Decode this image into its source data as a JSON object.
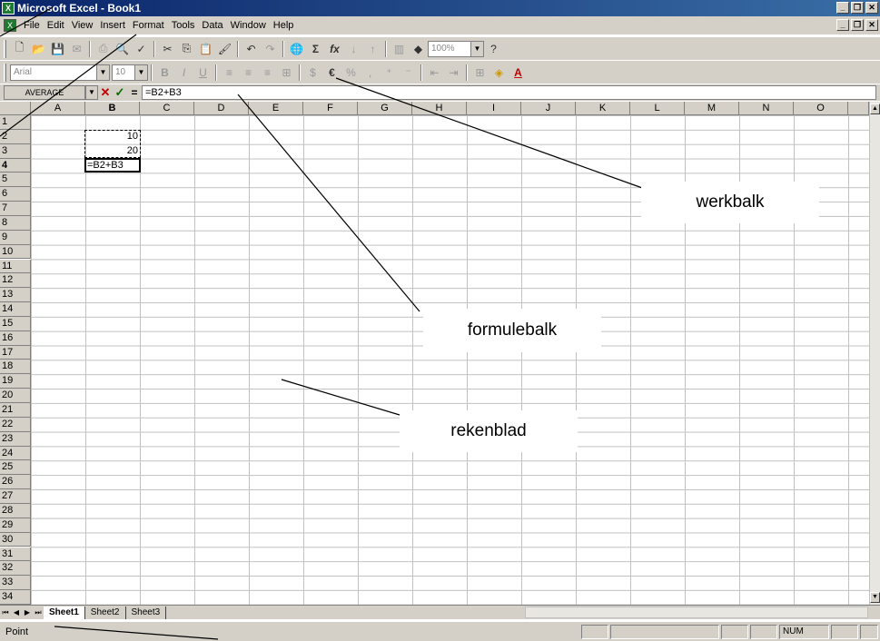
{
  "window": {
    "title": "Microsoft Excel - Book1",
    "app_icon": "excel-icon"
  },
  "menu": [
    {
      "label": "File",
      "accel": "F"
    },
    {
      "label": "Edit",
      "accel": "E"
    },
    {
      "label": "View",
      "accel": "V"
    },
    {
      "label": "Insert",
      "accel": "I"
    },
    {
      "label": "Format",
      "accel": "o"
    },
    {
      "label": "Tools",
      "accel": "T"
    },
    {
      "label": "Data",
      "accel": "D"
    },
    {
      "label": "Window",
      "accel": "W"
    },
    {
      "label": "Help",
      "accel": "H"
    }
  ],
  "toolbar": {
    "zoom": "100%",
    "font_name": "Arial",
    "font_size": "10"
  },
  "formula_bar": {
    "name_box": "AVERAGE",
    "cancel": "✕",
    "enter": "✓",
    "equals": "=",
    "formula": "=B2+B3"
  },
  "columns": [
    "A",
    "B",
    "C",
    "D",
    "E",
    "F",
    "G",
    "H",
    "I",
    "J",
    "K",
    "L",
    "M",
    "N",
    "O"
  ],
  "rows": [
    "1",
    "2",
    "3",
    "4",
    "5",
    "6",
    "7",
    "8",
    "9",
    "10",
    "11",
    "12",
    "13",
    "14",
    "15",
    "16",
    "17",
    "18",
    "19",
    "20",
    "21",
    "22",
    "23",
    "24",
    "25",
    "26",
    "27",
    "28",
    "29",
    "30",
    "31",
    "32",
    "33",
    "34"
  ],
  "cells": {
    "B2": "10",
    "B3": "20",
    "B4": "=B2+B3"
  },
  "sheets": [
    "Sheet1",
    "Sheet2",
    "Sheet3"
  ],
  "active_sheet": "Sheet1",
  "status": {
    "mode": "Point",
    "num": "NUM"
  },
  "callouts": {
    "werkbalk": "werkbalk",
    "formulebalk": "formulebalk",
    "rekenblad": "rekenblad"
  }
}
